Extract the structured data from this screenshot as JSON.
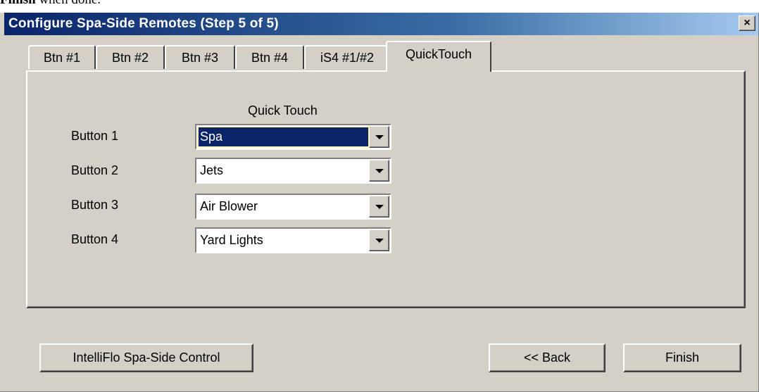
{
  "doc_fragment": {
    "bold": "Finish",
    "rest": " when done."
  },
  "window": {
    "title": "Configure Spa-Side Remotes (Step 5 of 5)",
    "close_glyph": "×"
  },
  "tabs": [
    {
      "label": "Btn #1",
      "active": false
    },
    {
      "label": "Btn #2",
      "active": false
    },
    {
      "label": "Btn #3",
      "active": false
    },
    {
      "label": "Btn #4",
      "active": false
    },
    {
      "label": "iS4 #1/#2",
      "active": false
    },
    {
      "label": "QuickTouch",
      "active": true
    }
  ],
  "quick_touch": {
    "heading": "Quick Touch",
    "rows": [
      {
        "label": "Button 1",
        "value": "Spa",
        "focused": true
      },
      {
        "label": "Button 2",
        "value": "Jets",
        "focused": false
      },
      {
        "label": "Button 3",
        "value": "Air Blower",
        "focused": false
      },
      {
        "label": "Button 4",
        "value": "Yard Lights",
        "focused": false
      }
    ]
  },
  "buttons": {
    "intelliflo": "IntelliFlo Spa-Side Control",
    "back": "<< Back",
    "finish": "Finish"
  },
  "colors": {
    "face": "#d4d0c8",
    "title_start": "#0a246a",
    "title_end": "#a6caf0",
    "selection": "#0a246a"
  }
}
